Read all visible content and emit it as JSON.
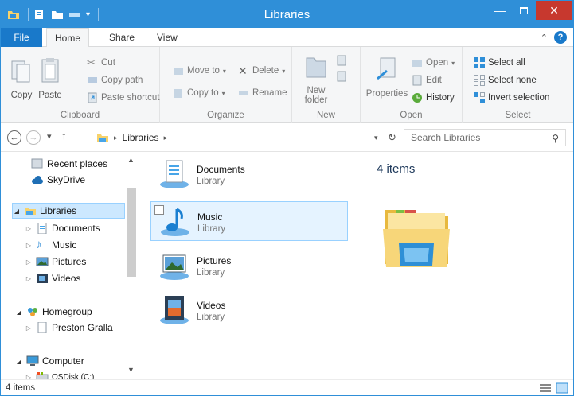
{
  "window": {
    "title": "Libraries"
  },
  "tabs": {
    "file": "File",
    "home": "Home",
    "share": "Share",
    "view": "View"
  },
  "ribbon": {
    "clipboard": {
      "label": "Clipboard",
      "copy": "Copy",
      "paste": "Paste",
      "cut": "Cut",
      "copy_path": "Copy path",
      "paste_shortcut": "Paste shortcut"
    },
    "organize": {
      "label": "Organize",
      "move_to": "Move to",
      "copy_to": "Copy to",
      "delete": "Delete",
      "rename": "Rename"
    },
    "new": {
      "label": "New",
      "new_folder_line1": "New",
      "new_folder_line2": "folder"
    },
    "open": {
      "label": "Open",
      "properties": "Properties",
      "open": "Open",
      "edit": "Edit",
      "history": "History"
    },
    "select": {
      "label": "Select",
      "select_all": "Select all",
      "select_none": "Select none",
      "invert_selection": "Invert selection"
    }
  },
  "address": {
    "path": [
      "Libraries"
    ],
    "search_placeholder": "Search Libraries"
  },
  "navpane": {
    "items": [
      {
        "label": "Recent places"
      },
      {
        "label": "SkyDrive"
      },
      {
        "label": "Libraries"
      },
      {
        "label": "Documents"
      },
      {
        "label": "Music"
      },
      {
        "label": "Pictures"
      },
      {
        "label": "Videos"
      },
      {
        "label": "Homegroup"
      },
      {
        "label": "Preston Gralla"
      },
      {
        "label": "Computer"
      },
      {
        "label": "OSDisk (C:)"
      }
    ]
  },
  "libraries": [
    {
      "name": "Documents",
      "type": "Library"
    },
    {
      "name": "Music",
      "type": "Library"
    },
    {
      "name": "Pictures",
      "type": "Library"
    },
    {
      "name": "Videos",
      "type": "Library"
    }
  ],
  "details": {
    "count": "4 items"
  },
  "statusbar": {
    "count": "4 items"
  },
  "colors": {
    "accent": "#2f8fd8",
    "file_tab": "#1979ca",
    "close": "#c7382e",
    "selection": "#cce8ff"
  }
}
